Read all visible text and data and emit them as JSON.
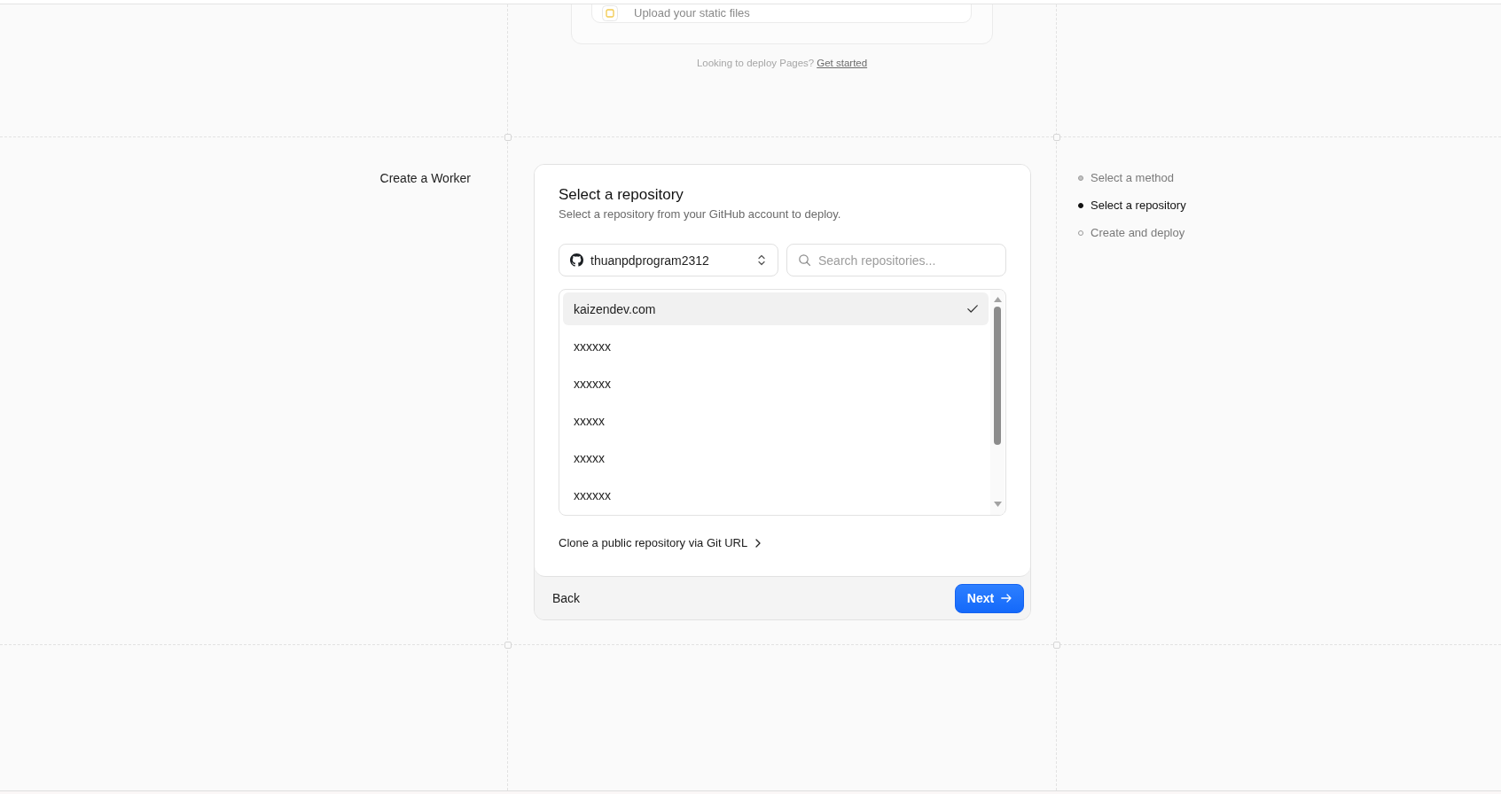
{
  "upload_card": {
    "option": {
      "label": "Upload your static files"
    }
  },
  "pages_hint": {
    "text": "Looking to deploy Pages?",
    "link": "Get started"
  },
  "section_label": "Create a Worker",
  "repository_card": {
    "title": "Select a repository",
    "subtitle": "Select a repository from your GitHub account to deploy.",
    "account_select": {
      "value": "thuanpdprogram2312"
    },
    "search": {
      "placeholder": "Search repositories..."
    },
    "repositories": [
      {
        "name": "kaizendev.com",
        "selected": true
      },
      {
        "name": "xxxxxx",
        "selected": false
      },
      {
        "name": "xxxxxx",
        "selected": false
      },
      {
        "name": "xxxxx",
        "selected": false
      },
      {
        "name": "xxxxx",
        "selected": false
      },
      {
        "name": "xxxxxx",
        "selected": false
      }
    ],
    "clone_link": "Clone a public repository via Git URL",
    "back_button": "Back",
    "next_button": "Next"
  },
  "steps": [
    {
      "label": "Select a method",
      "selected": false,
      "completed": true
    },
    {
      "label": "Select a repository",
      "selected": true,
      "completed": false
    },
    {
      "label": "Create and deploy",
      "selected": false,
      "completed": false
    }
  ]
}
